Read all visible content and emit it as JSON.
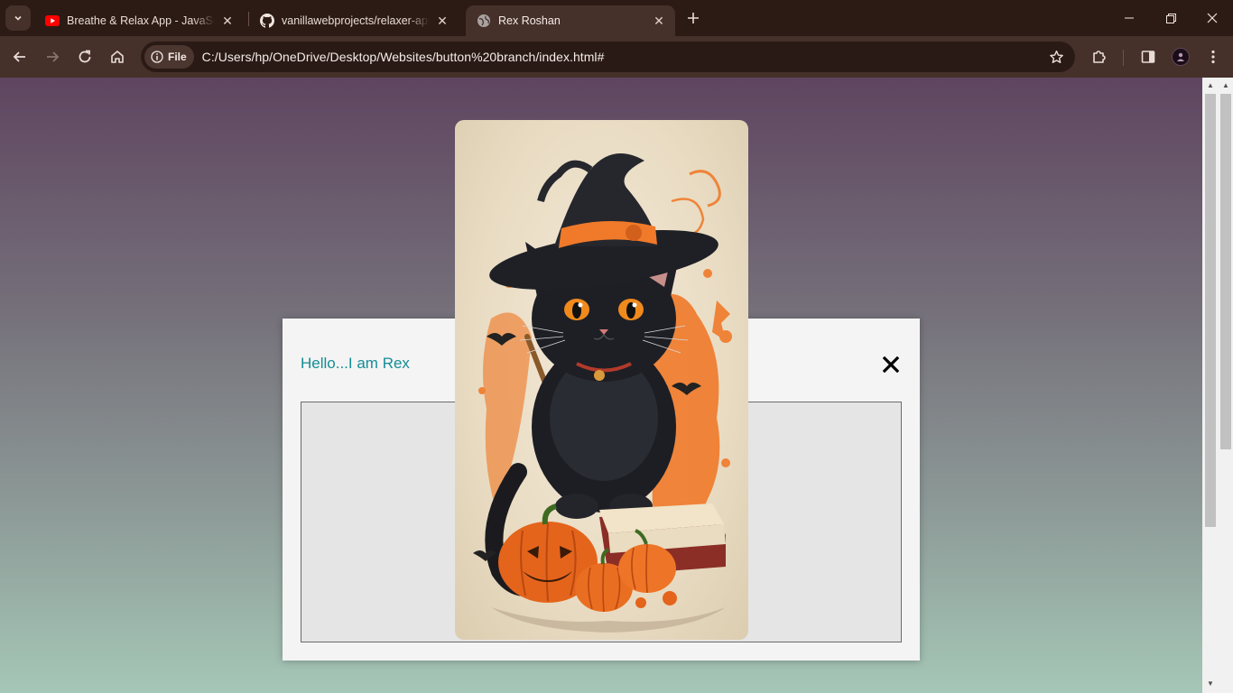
{
  "browser": {
    "tabs": [
      {
        "title": "Breathe & Relax App - JavaScript",
        "favicon": "youtube-icon",
        "active": false
      },
      {
        "title": "vanillawebprojects/relaxer-app/",
        "favicon": "github-icon",
        "active": false
      },
      {
        "title": "Rex Roshan",
        "favicon": "globe-icon",
        "active": true
      }
    ],
    "address_bar": {
      "chip_label": "File",
      "url": "C:/Users/hp/OneDrive/Desktop/Websites/button%20branch/index.html#"
    }
  },
  "page": {
    "modal": {
      "title": "Hello...I am Rex",
      "close_icon": "close-icon"
    },
    "card": {
      "image": "black-cat-witch-hat-halloween-illustration"
    }
  },
  "colors": {
    "tabstrip_bg": "#2c1a14",
    "toolbar_bg": "#46302a",
    "modal_title": "#138d96",
    "accent_orange": "#f07a2a"
  }
}
